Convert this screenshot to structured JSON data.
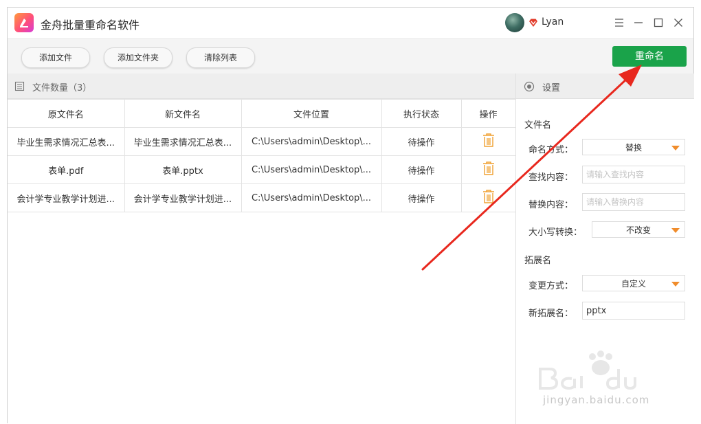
{
  "app": {
    "title": "金舟批量重命名软件",
    "username": "Lyan"
  },
  "toolbar": {
    "add_file": "添加文件",
    "add_folder": "添加文件夹",
    "clear_list": "清除列表",
    "rename": "重命名"
  },
  "list": {
    "count_label": "文件数量（3）",
    "columns": [
      "原文件名",
      "新文件名",
      "文件位置",
      "执行状态",
      "操作"
    ],
    "rows": [
      {
        "original": "毕业生需求情况汇总表...",
        "new": "毕业生需求情况汇总表...",
        "location": "C:\\Users\\admin\\Desktop\\...",
        "status": "待操作"
      },
      {
        "original": "表单.pdf",
        "new": "表单.pptx",
        "location": "C:\\Users\\admin\\Desktop\\...",
        "status": "待操作"
      },
      {
        "original": "会计学专业教学计划进...",
        "new": "会计学专业教学计划进...",
        "location": "C:\\Users\\admin\\Desktop\\...",
        "status": "待操作"
      }
    ]
  },
  "settings": {
    "title": "设置",
    "filename_section": "文件名",
    "naming_mode_label": "命名方式：",
    "naming_mode_value": "替换",
    "find_label": "查找内容：",
    "find_placeholder": "请输入查找内容",
    "replace_label": "替换内容：",
    "replace_placeholder": "请输入替换内容",
    "case_label": "大小写转换：",
    "case_value": "不改变",
    "ext_section": "拓展名",
    "change_mode_label": "变更方式：",
    "change_mode_value": "自定义",
    "new_ext_label": "新拓展名：",
    "new_ext_value": "pptx"
  },
  "watermark": {
    "text": "jingyan.baidu.com"
  },
  "colors": {
    "accent_green": "#1aa34a",
    "trash_orange": "#f0a030",
    "arrow_red": "#e8281e"
  }
}
